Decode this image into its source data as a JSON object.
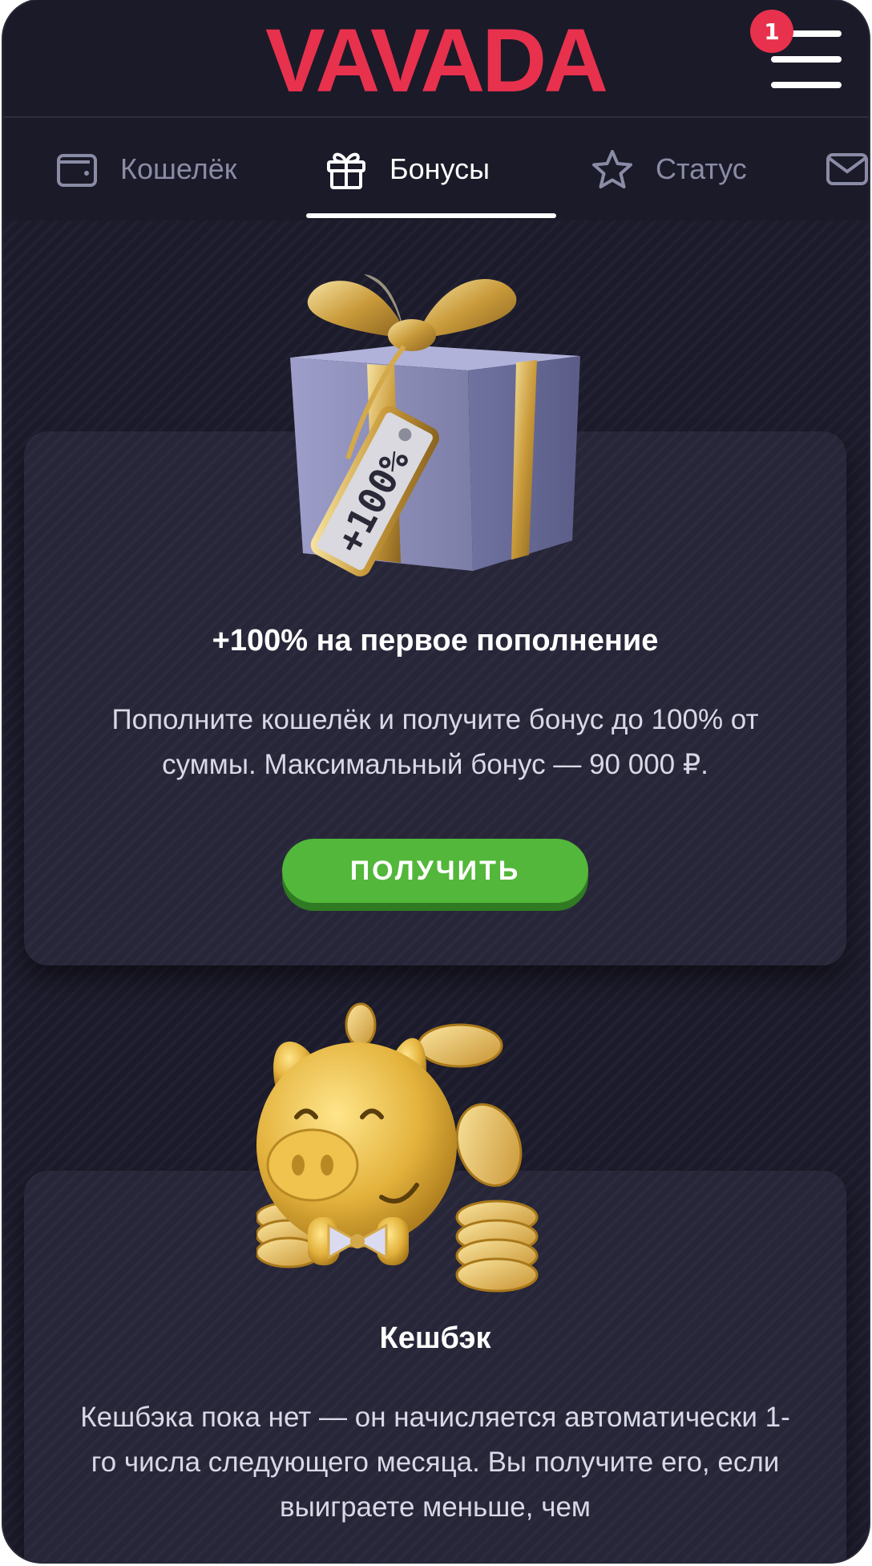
{
  "header": {
    "logo_text": "VAVADA",
    "notification_count": "1"
  },
  "tabs": [
    {
      "label": "Кошелёк",
      "icon": "wallet-icon",
      "active": false
    },
    {
      "label": "Бонусы",
      "icon": "gift-icon",
      "active": true
    },
    {
      "label": "Статус",
      "icon": "star-icon",
      "active": false
    },
    {
      "label": "",
      "icon": "mail-icon",
      "active": false
    }
  ],
  "bonuses": [
    {
      "image": "gift-box-100-percent",
      "title": "+100% на первое пополнение",
      "text": "Пополните кошелёк и получите бонус до 100% от суммы. Максимальный бонус — 90 000 ₽.",
      "button": "ПОЛУЧИТЬ",
      "tag_text": "+100%"
    },
    {
      "image": "golden-piggy-bank",
      "title": "Кешбэк",
      "text": "Кешбэка пока нет — он начисляется автоматически 1-го числа следующего месяца. Вы получите его, если выиграете меньше, чем"
    }
  ],
  "colors": {
    "brand": "#e8314d",
    "background": "#1c1b2b",
    "card": "#272638",
    "button": "#52b73a",
    "tab_inactive": "#8a8ca6"
  }
}
